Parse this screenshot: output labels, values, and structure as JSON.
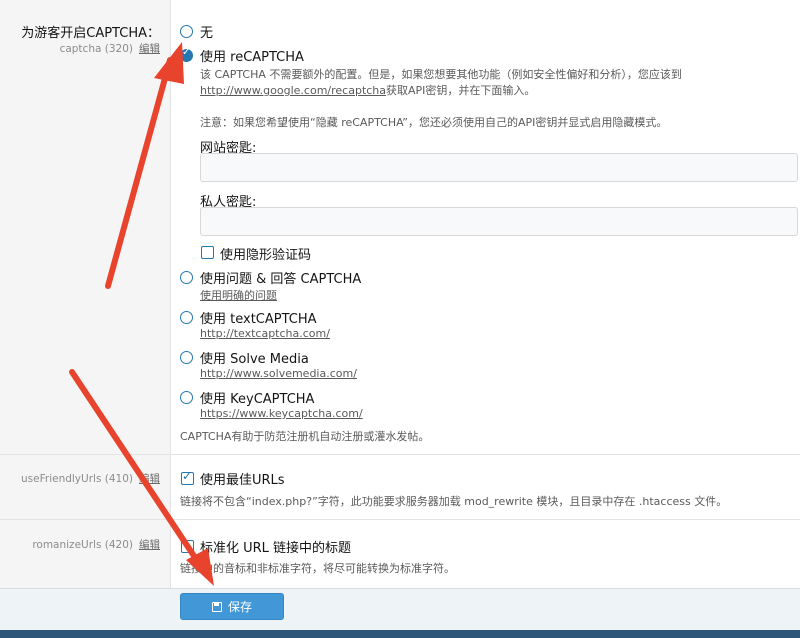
{
  "captcha_option": {
    "title": "为游客开启CAPTCHA：",
    "key": "captcha",
    "order": "(320)",
    "edit": "编辑",
    "options": [
      {
        "label": "无",
        "checked": false
      },
      {
        "label": "使用 reCAPTCHA",
        "checked": true
      },
      {
        "label": "使用问题 & 回答 CAPTCHA",
        "checked": false,
        "link": "使用明确的问题"
      },
      {
        "label": "使用 textCAPTCHA",
        "checked": false,
        "link": "http://textcaptcha.com/"
      },
      {
        "label": "使用 Solve Media",
        "checked": false,
        "link": "http://www.solvemedia.com/"
      },
      {
        "label": "使用 KeyCAPTCHA",
        "checked": false,
        "link": "https://www.keycaptcha.com/"
      }
    ],
    "recaptcha": {
      "desc_line1": "该 CAPTCHA 不需要额外的配置。但是，如果您想要其他功能（例如安全性偏好和分析），您应该到",
      "desc_link": "http://www.google.com/recaptcha",
      "desc_line2_rest": "获取API密钥，并在下面输入。",
      "note": "注意：如果您希望使用“隐藏 reCAPTCHA”，您还必须使用自己的API密钥并显式启用隐藏模式。",
      "site_key_label": "网站密匙:",
      "site_key_value": "",
      "secret_key_label": "私人密匙:",
      "secret_key_value": "",
      "invisible_label": "使用隐形验证码",
      "invisible_checked": false
    },
    "explain": "CAPTCHA有助于防范注册机自动注册或灌水发帖。"
  },
  "friendly_urls_option": {
    "key": "useFriendlyUrls",
    "order": "(410)",
    "edit": "编辑",
    "label": "使用最佳URLs",
    "checked": true,
    "desc": "链接将不包含“index.php?”字符，此功能要求服务器加载 mod_rewrite 模块，且目录中存在 .htaccess 文件。"
  },
  "romanize_option": {
    "key": "romanizeUrls",
    "order": "(420)",
    "edit": "编辑",
    "label": "标准化 URL 链接中的标题",
    "checked": false,
    "desc": "链接中的音标和非标准字符，将尽可能转换为标准字符。"
  },
  "footer": {
    "save_label": "保存"
  },
  "colors": {
    "accent": "#2577b1",
    "button": "#4298d7",
    "arrow": "#e8432c"
  },
  "icons": [
    "save-icon"
  ]
}
